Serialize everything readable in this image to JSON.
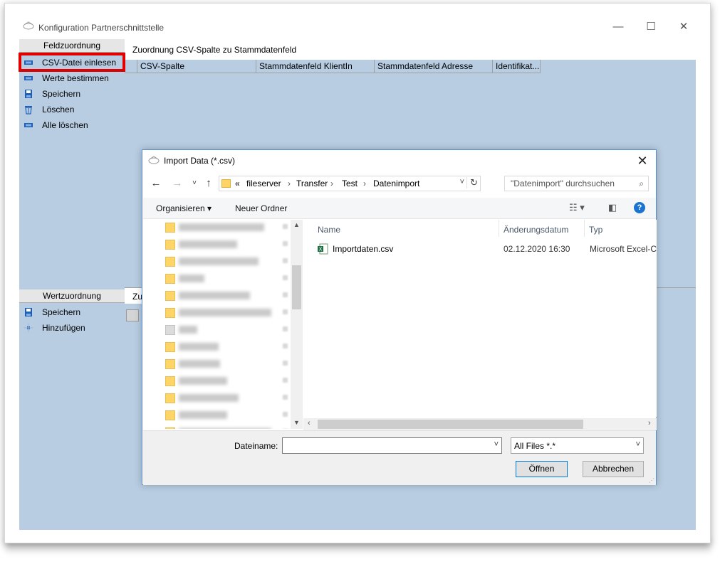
{
  "window": {
    "title": "Konfiguration Partnerschnittstelle",
    "controls": {
      "minimize": "—",
      "maximize": "☐",
      "close": "✕"
    }
  },
  "sidebar_top": {
    "header": "Feldzuordnung",
    "items": [
      {
        "label": "CSV-Datei einlesen",
        "icon": "monitor-icon"
      },
      {
        "label": "Werte bestimmen",
        "icon": "monitor-icon"
      },
      {
        "label": "Speichern",
        "icon": "save-disk-icon"
      },
      {
        "label": "Löschen",
        "icon": "trash-icon"
      },
      {
        "label": "Alle löschen",
        "icon": "monitor-icon"
      }
    ]
  },
  "sidebar_bottom": {
    "header": "Wertzuordnung",
    "items": [
      {
        "label": "Speichern",
        "icon": "save-disk-icon"
      },
      {
        "label": "Hinzufügen",
        "icon": "add-plus-icon"
      }
    ]
  },
  "main": {
    "header": "Zuordnung CSV-Spalte zu Stammdatenfeld",
    "columns": [
      "CSV-Spalte",
      "Stammdatenfeld KlientIn",
      "Stammdatenfeld Adresse",
      "Identifikat..."
    ],
    "header2": "Zu"
  },
  "dialog": {
    "title": "Import Data (*.csv)",
    "breadcrumb": [
      "«",
      "fileserver",
      "Transfer",
      "Test",
      "Datenimport"
    ],
    "search_placeholder": "\"Datenimport\" durchsuchen",
    "toolbar": {
      "organize": "Organisieren ▾",
      "new_folder": "Neuer Ordner"
    },
    "columns": {
      "name": "Name",
      "date": "Änderungsdatum",
      "type": "Typ"
    },
    "files": [
      {
        "name": "Importdaten.csv",
        "date": "02.12.2020 16:30",
        "type": "Microsoft Excel-C"
      }
    ],
    "filename_label": "Dateiname:",
    "filename_value": "",
    "filter": "All Files *.*",
    "open_button": "Öffnen",
    "cancel_button": "Abbrechen"
  },
  "colors": {
    "panel_bg": "#b8cde2",
    "highlight": "#e00000",
    "folder": "#ffd567",
    "accent": "#0078d7"
  }
}
